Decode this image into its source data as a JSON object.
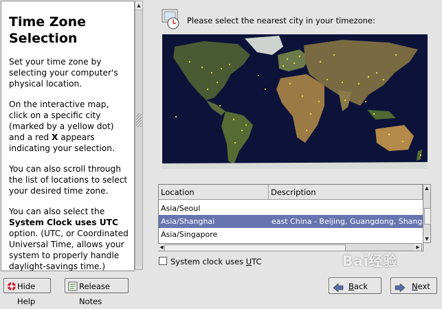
{
  "help": {
    "title": "Time Zone Selection",
    "p1": "Set your time zone by selecting your computer's physical location.",
    "p2_pre": "On the interactive map, click on a specific city (marked by a yellow dot) and a red ",
    "p2_bold": "X",
    "p2_post": " appears indicating your selection.",
    "p3": "You can also scroll through the list of locations to select your desired time zone.",
    "p4_pre": "You can also select the ",
    "p4_bold": "System Clock uses UTC",
    "p4_post": " option. (UTC, or Coordinated Universal Time, allows your system to properly handle daylight-savings time.) Select"
  },
  "prompt": "Please select the nearest city in your timezone:",
  "list": {
    "headers": {
      "location": "Location",
      "description": "Description"
    },
    "rows": [
      {
        "location": "Asia/Seoul",
        "description": ""
      },
      {
        "location": "Asia/Shanghai",
        "description": "east China - Beijing, Guangdong, Shanghai, etc."
      },
      {
        "location": "Asia/Singapore",
        "description": ""
      }
    ],
    "selected_index": 1
  },
  "utc_checkbox": {
    "label_pre": "System clock uses ",
    "label_mnemonic": "U",
    "label_post": "TC",
    "checked": false
  },
  "buttons": {
    "hide_help": "Hide Help",
    "release_notes": "Release Notes",
    "back_mnemonic": "B",
    "back_rest": "ack",
    "next_mnemonic": "N",
    "next_rest": "ext"
  },
  "colors": {
    "selection": "#6675b0",
    "map_ocean": "#0c1238",
    "city_dot": "#f2e24a"
  },
  "icons": {
    "prompt": "clock-icon",
    "hide_help": "lifebuoy-icon",
    "release_notes": "notes-icon",
    "back": "back-arrow-icon",
    "next": "next-arrow-icon"
  },
  "watermark": "Bai经验"
}
